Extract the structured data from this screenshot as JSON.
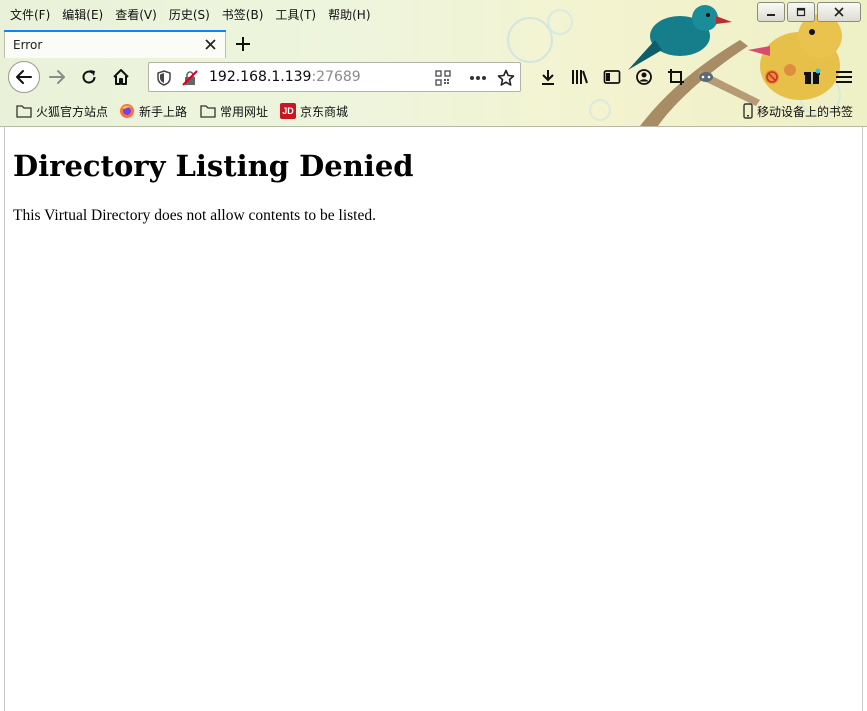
{
  "menubar": {
    "items": [
      {
        "label": "文件(F)"
      },
      {
        "label": "编辑(E)"
      },
      {
        "label": "查看(V)"
      },
      {
        "label": "历史(S)"
      },
      {
        "label": "书签(B)"
      },
      {
        "label": "工具(T)"
      },
      {
        "label": "帮助(H)"
      }
    ]
  },
  "tabs": [
    {
      "title": "Error",
      "active": true
    }
  ],
  "urlbar": {
    "host": "192.168.1.139",
    "port": ":27689"
  },
  "bookmarks": {
    "items": [
      {
        "label": "火狐官方站点",
        "icon": "folder-icon"
      },
      {
        "label": "新手上路",
        "icon": "firefox-icon"
      },
      {
        "label": "常用网址",
        "icon": "folder-icon"
      },
      {
        "label": "京东商城",
        "icon": "jd-icon",
        "icon_text": "JD"
      }
    ],
    "mobile_label": "移动设备上的书签"
  },
  "page": {
    "heading": "Directory Listing Denied",
    "message": "This Virtual Directory does not allow contents to be listed."
  },
  "colors": {
    "accent": "#0a84ff",
    "insecure": "#d70022",
    "jd": "#c81623"
  }
}
